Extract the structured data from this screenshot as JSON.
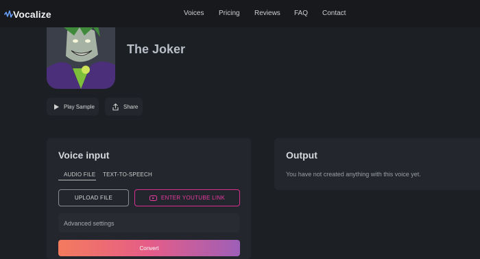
{
  "nav": {
    "logo": "Vocalize",
    "links": [
      "Voices",
      "Pricing",
      "Reviews",
      "FAQ",
      "Contact"
    ]
  },
  "voice": {
    "name": "The Joker",
    "play_label": "Play Sample",
    "share_label": "Share"
  },
  "input_card": {
    "title": "Voice input",
    "tabs": [
      "AUDIO FILE",
      "TEXT-TO-SPEECH"
    ],
    "active_tab": "AUDIO FILE",
    "upload_label": "UPLOAD FILE",
    "youtube_label": "ENTER YOUTUBE LINK",
    "advanced_label": "Advanced settings",
    "convert_label": "Convert"
  },
  "output_card": {
    "title": "Output",
    "message": "You have not created anything with this voice yet."
  },
  "colors": {
    "background": "#1c1f24",
    "card": "#23262c",
    "accent_pink": "#e83b9f",
    "gradient_start": "#f47b5e",
    "gradient_end": "#9e5fb8"
  },
  "icons": [
    "vocalize-logo-icon",
    "play-icon",
    "share-icon",
    "youtube-icon"
  ]
}
